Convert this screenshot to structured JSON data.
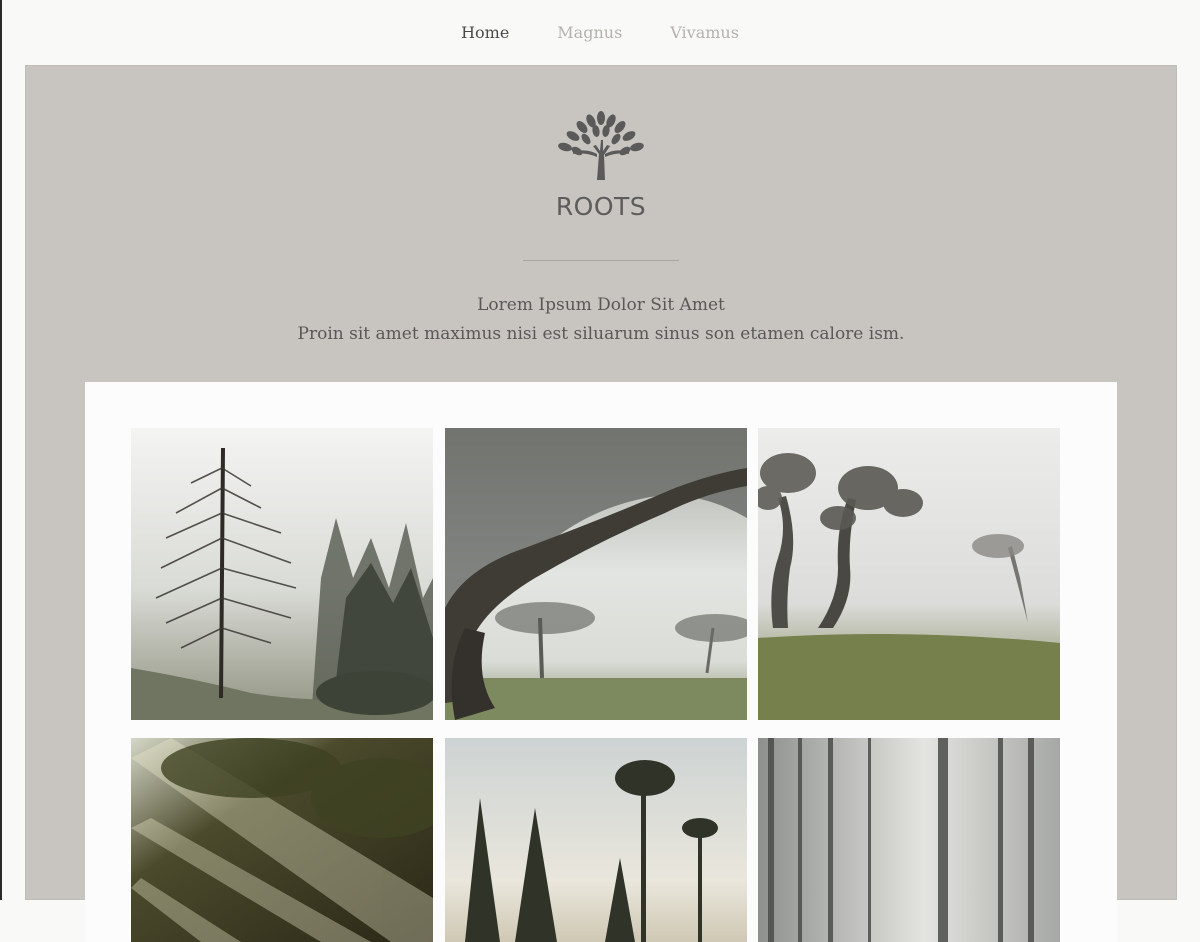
{
  "nav": {
    "items": [
      {
        "label": "Home",
        "active": true
      },
      {
        "label": "Magnus",
        "active": false
      },
      {
        "label": "Vivamus",
        "active": false
      }
    ]
  },
  "header": {
    "logo_icon": "tree-icon",
    "brand": "ROOTS",
    "tagline_line1": "Lorem Ipsum Dolor Sit Amet",
    "tagline_line2": "Proin sit amet maximus nisi est siluarum sinus son etamen calore ism."
  },
  "colors": {
    "page_bg": "#f9f9f8",
    "hero_bg": "#c8c5c0",
    "panel_bg": "#fcfcfc",
    "nav_active": "#4a4a4a",
    "nav_inactive": "#b4b2ad",
    "brand_text": "#5c5c5c"
  },
  "gallery": {
    "images": [
      {
        "subject": "misty larch tree and pine forest"
      },
      {
        "subject": "twisted laurel tree in fog"
      },
      {
        "subject": "foggy meadow with bent trees"
      },
      {
        "subject": "sun rays through dark forest"
      },
      {
        "subject": "tall pines against pale sky"
      },
      {
        "subject": "misty birch forest"
      }
    ]
  }
}
